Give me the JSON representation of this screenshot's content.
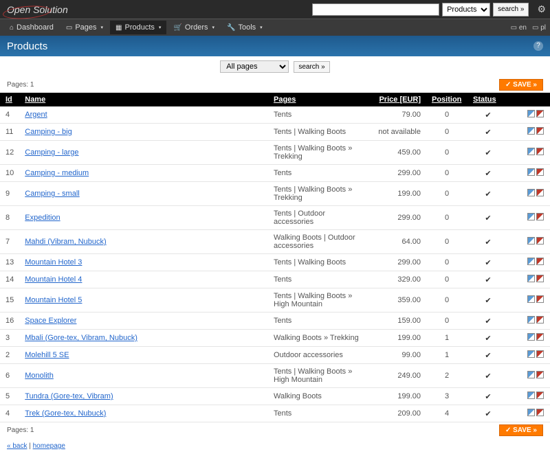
{
  "logo": "Open Solution",
  "search": {
    "placeholder": "",
    "dropdown": "Products",
    "button": "search »"
  },
  "nav": {
    "dashboard": "Dashboard",
    "pages": "Pages",
    "products": "Products",
    "orders": "Orders",
    "tools": "Tools",
    "lang1": "en",
    "lang2": "pl"
  },
  "title": "Products",
  "filter": {
    "allpages": "All pages",
    "search": "search »"
  },
  "pages_label": "Pages:",
  "pages_num": "1",
  "save": "✓ SAVE »",
  "columns": {
    "id": "Id",
    "name": "Name",
    "pages": "Pages",
    "price": "Price",
    "currency": "[EUR]",
    "position": "Position",
    "status": "Status"
  },
  "rows": [
    {
      "id": "4",
      "name": "Argent",
      "pages": "Tents",
      "price": "79.00",
      "pos": "0",
      "status": "✔"
    },
    {
      "id": "11",
      "name": "Camping - big",
      "pages": "Tents | Walking Boots",
      "price": "not available",
      "pos": "0",
      "status": "✔"
    },
    {
      "id": "12",
      "name": "Camping - large",
      "pages": "Tents | Walking Boots » Trekking",
      "price": "459.00",
      "pos": "0",
      "status": "✔"
    },
    {
      "id": "10",
      "name": "Camping - medium",
      "pages": "Tents",
      "price": "299.00",
      "pos": "0",
      "status": "✔"
    },
    {
      "id": "9",
      "name": "Camping - small",
      "pages": "Tents | Walking Boots » Trekking",
      "price": "199.00",
      "pos": "0",
      "status": "✔"
    },
    {
      "id": "8",
      "name": "Expedition",
      "pages": "Tents | Outdoor accessories",
      "price": "299.00",
      "pos": "0",
      "status": "✔"
    },
    {
      "id": "7",
      "name": "Mahdi (Vibram, Nubuck)",
      "pages": "Walking Boots | Outdoor accessories",
      "price": "64.00",
      "pos": "0",
      "status": "✔"
    },
    {
      "id": "13",
      "name": "Mountain Hotel 3",
      "pages": "Tents | Walking Boots",
      "price": "299.00",
      "pos": "0",
      "status": "✔"
    },
    {
      "id": "14",
      "name": "Mountain Hotel 4",
      "pages": "Tents",
      "price": "329.00",
      "pos": "0",
      "status": "✔"
    },
    {
      "id": "15",
      "name": "Mountain Hotel 5",
      "pages": "Tents | Walking Boots » High Mountain",
      "price": "359.00",
      "pos": "0",
      "status": "✔"
    },
    {
      "id": "16",
      "name": "Space Explorer",
      "pages": "Tents",
      "price": "159.00",
      "pos": "0",
      "status": "✔"
    },
    {
      "id": "3",
      "name": "Mbali (Gore-tex, Vibram, Nubuck)",
      "pages": "Walking Boots » Trekking",
      "price": "199.00",
      "pos": "1",
      "status": "✔"
    },
    {
      "id": "2",
      "name": "Molehill 5 SE",
      "pages": "Outdoor accessories",
      "price": "99.00",
      "pos": "1",
      "status": "✔"
    },
    {
      "id": "6",
      "name": "Monolith",
      "pages": "Tents | Walking Boots » High Mountain",
      "price": "249.00",
      "pos": "2",
      "status": "✔"
    },
    {
      "id": "5",
      "name": "Tundra (Gore-tex, Vibram)",
      "pages": "Walking Boots",
      "price": "199.00",
      "pos": "3",
      "status": "✔"
    },
    {
      "id": "4",
      "name": "Trek (Gore-tex, Nubuck)",
      "pages": "Tents",
      "price": "209.00",
      "pos": "4",
      "status": "✔"
    }
  ],
  "footer": {
    "back": "« back",
    "sep": " | ",
    "home": "homepage"
  }
}
